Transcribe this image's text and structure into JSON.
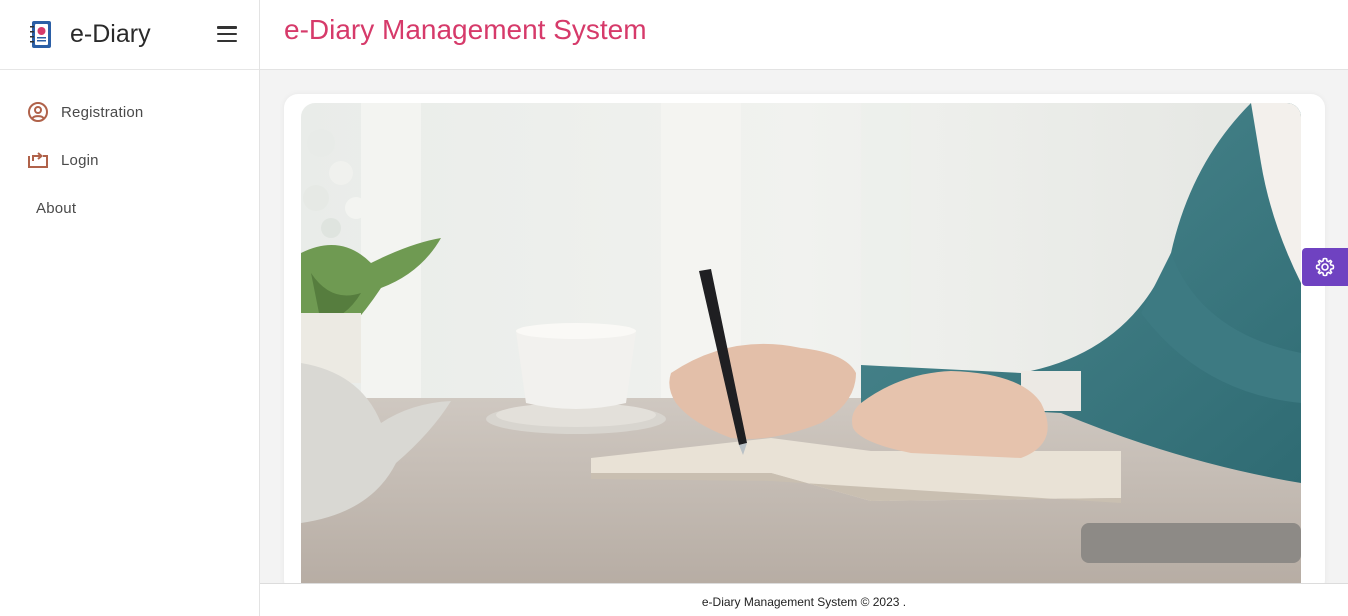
{
  "brand": {
    "name": "e-Diary"
  },
  "sidebar": {
    "items": [
      {
        "label": "Registration",
        "icon": "user-circle-icon"
      },
      {
        "label": "Login",
        "icon": "login-arrow-icon"
      },
      {
        "label": "About"
      }
    ]
  },
  "header": {
    "title": "e-Diary Management System"
  },
  "main": {
    "hero_image": "person-writing-in-diary-photo"
  },
  "settings": {
    "icon": "gear-icon"
  },
  "footer": {
    "text": "e-Diary Management System © 2023 ."
  },
  "colors": {
    "title": "#d63a6a",
    "nav_icon": "#b0624a",
    "settings_button": "#6f42c1"
  }
}
